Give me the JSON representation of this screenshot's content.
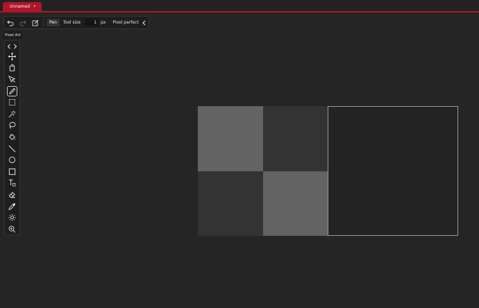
{
  "tabs": [
    {
      "label": "Unnamed",
      "modified_marker": "•"
    }
  ],
  "colors": {
    "accent": "#b0152a",
    "background": "#252525",
    "panel": "#1e1e1e"
  },
  "toolbar": {
    "undo_icon": "undo-icon",
    "redo_icon": "redo-icon",
    "edit_icon": "edit-icon",
    "active_tool_label": "Pen",
    "tool_size_label": "Tool size",
    "tool_size_value": "1",
    "tool_size_unit": "px",
    "pixel_perfect_label": "Pixel perfect",
    "collapse_icon": "chevron-left-icon"
  },
  "tool_set": {
    "label": "Pixel Art"
  },
  "tools": [
    "move",
    "crop-rotate",
    "select-pointer",
    "pen",
    "rect-select",
    "magic-wand",
    "lasso",
    "fill",
    "line",
    "ellipse",
    "rectangle",
    "text",
    "eraser",
    "eyedropper",
    "brightness",
    "zoom"
  ],
  "active_tool": "pen"
}
